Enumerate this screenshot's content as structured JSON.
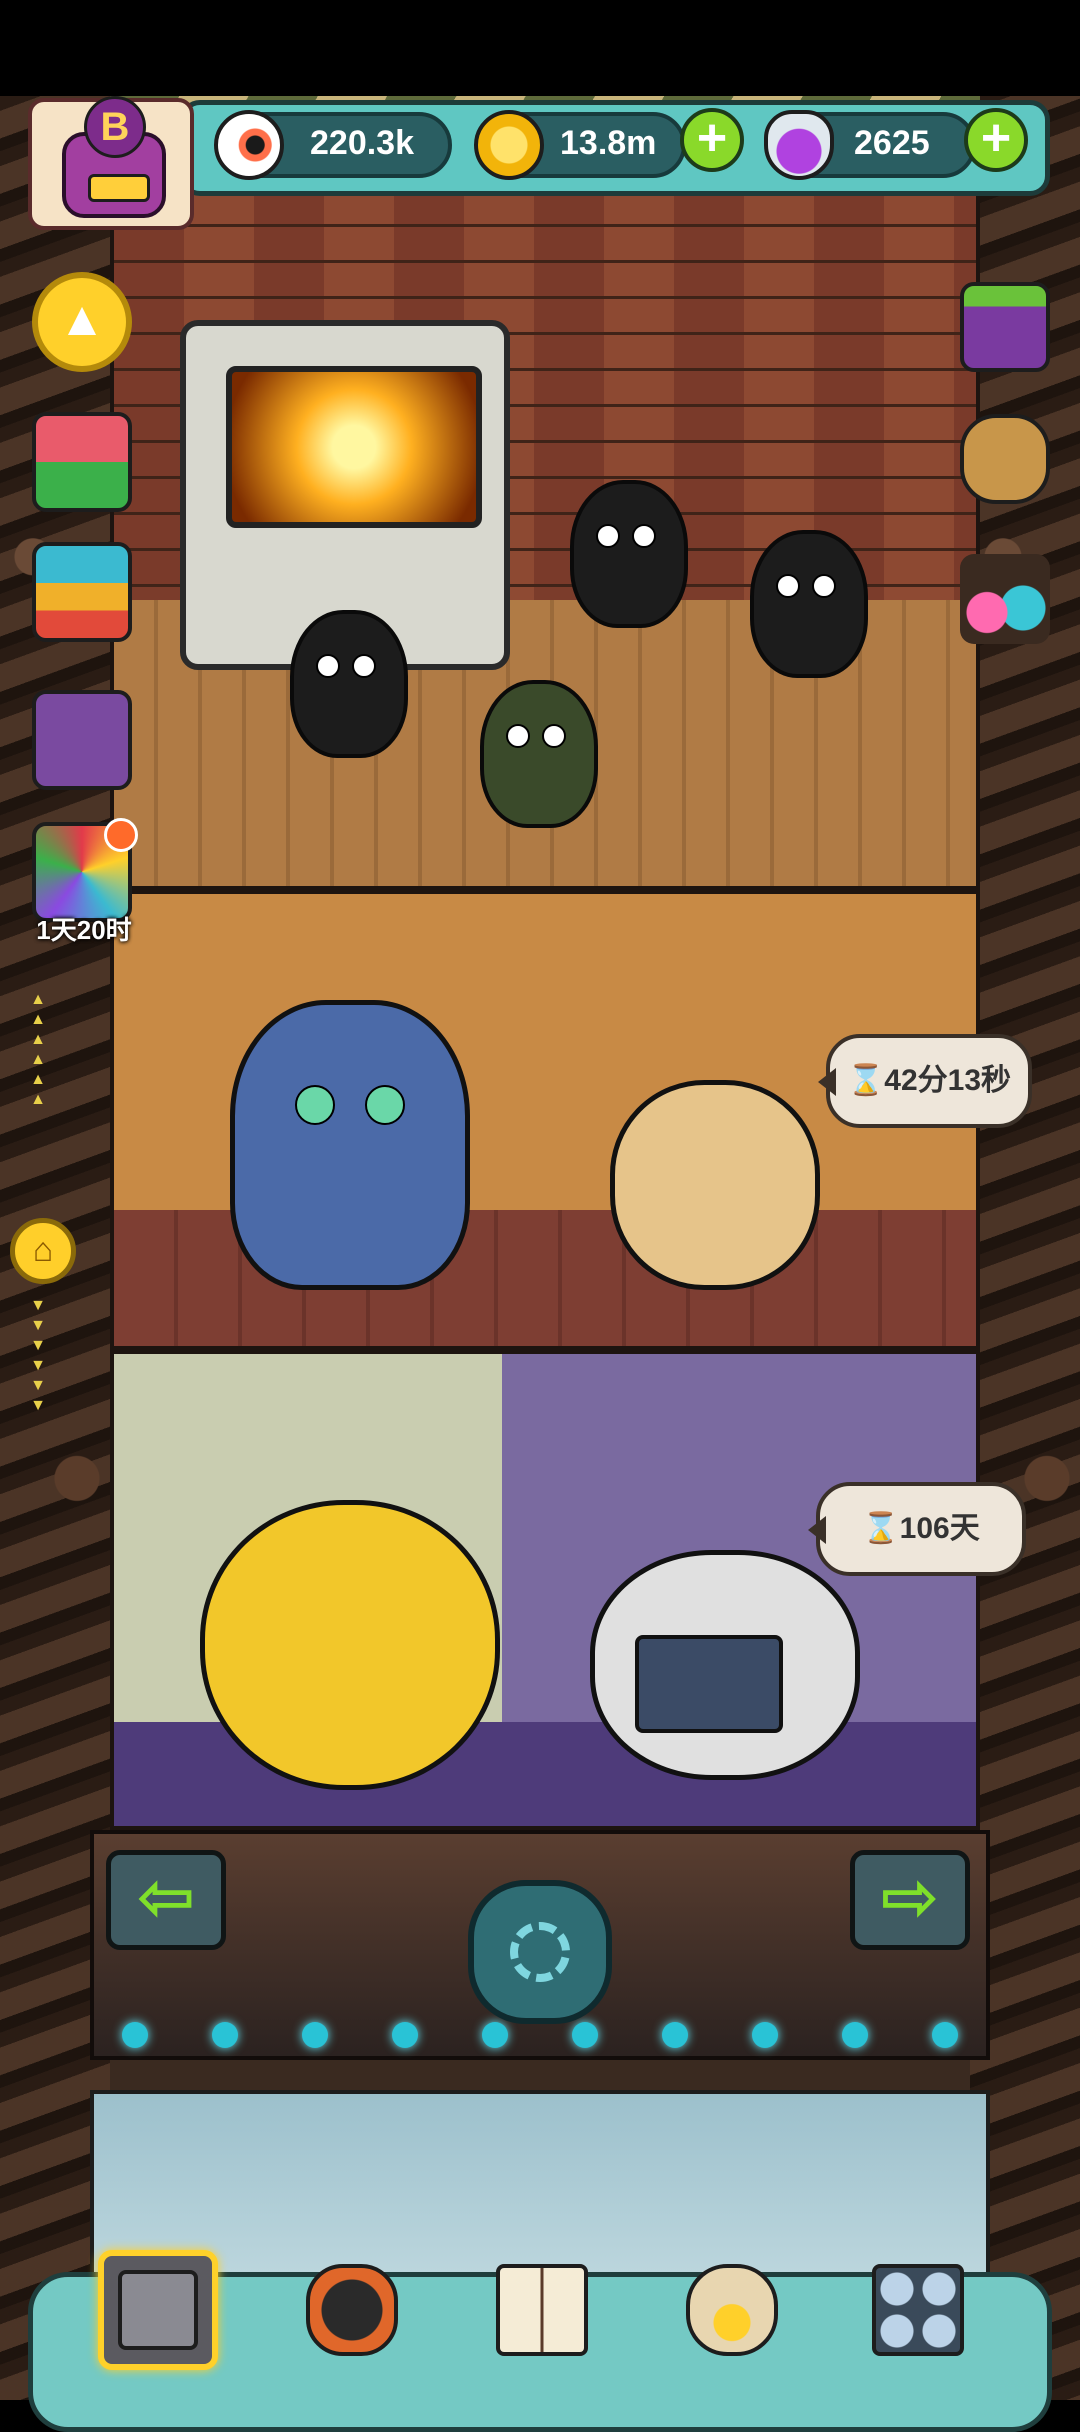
{
  "hud": {
    "eyeballs": {
      "value": "220.3k",
      "icon": "eyeball-icon"
    },
    "coins": {
      "value": "13.8m",
      "icon": "coin-icon",
      "add": "+"
    },
    "potions": {
      "value": "2625",
      "icon": "potion-icon",
      "add": "+"
    },
    "badge_letter": "B"
  },
  "left_menu": {
    "up_arrow": "▲",
    "limited_event_timer": "1天20时",
    "home": "⌂"
  },
  "rooms": [
    {
      "name": "furnace-room",
      "timer": ""
    },
    {
      "name": "cat-room",
      "timer": "42分13秒",
      "hourglass": "⌛"
    },
    {
      "name": "lab-room",
      "timer": "106天",
      "hourglass": "⌛"
    }
  ],
  "nav": {
    "prev": "⇦",
    "next": "⇨"
  },
  "bottom_tabs": [
    {
      "name": "tower",
      "active": true
    },
    {
      "name": "monsters",
      "active": false
    },
    {
      "name": "book",
      "active": false
    },
    {
      "name": "shop",
      "active": false
    },
    {
      "name": "menu",
      "active": false
    }
  ],
  "colors": {
    "hud_teal": "#5fc7c2",
    "accent_yellow": "#ffd12a",
    "plus_green": "#8ad92a"
  }
}
